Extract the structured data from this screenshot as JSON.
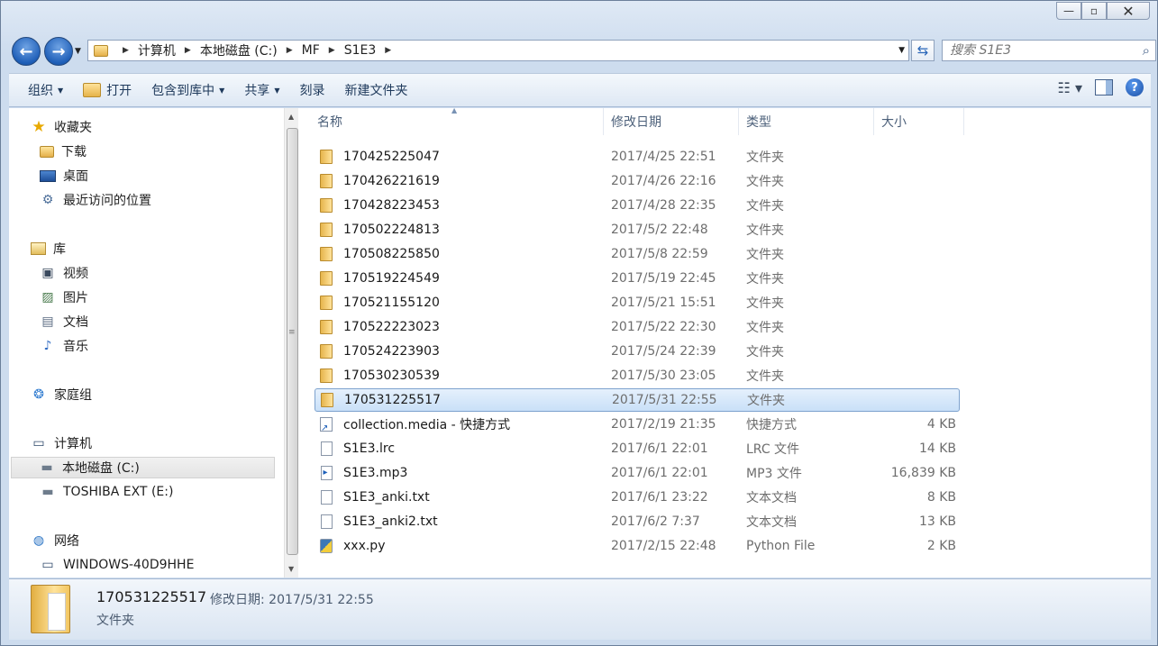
{
  "window": {
    "caption": {
      "minimize": "—",
      "maximize": "▫",
      "close": "✕"
    }
  },
  "nav": {
    "back_icon": "arrow-left-icon",
    "forward_icon": "arrow-right-icon",
    "breadcrumb": [
      "计算机",
      "本地磁盘 (C:)",
      "MF",
      "S1E3"
    ],
    "search_placeholder": "搜索 S1E3"
  },
  "toolbar": {
    "organize": "组织",
    "open": "打开",
    "include_library": "包含到库中",
    "share": "共享",
    "burn": "刻录",
    "new_folder": "新建文件夹"
  },
  "sidebar": {
    "favorites": "收藏夹",
    "downloads": "下载",
    "desktop": "桌面",
    "recent": "最近访问的位置",
    "libraries": "库",
    "videos": "视频",
    "pictures": "图片",
    "documents": "文档",
    "music": "音乐",
    "homegroup": "家庭组",
    "computer": "计算机",
    "local_disk": "本地磁盘 (C:)",
    "external": "TOSHIBA EXT (E:)",
    "network": "网络",
    "network_pc": "WINDOWS-40D9HHE"
  },
  "columns": {
    "name": "名称",
    "date": "修改日期",
    "type": "类型",
    "size": "大小"
  },
  "files": [
    {
      "name": "170425225047",
      "date": "2017/4/25 22:51",
      "type": "文件夹",
      "size": "",
      "icon": "folder"
    },
    {
      "name": "170426221619",
      "date": "2017/4/26 22:16",
      "type": "文件夹",
      "size": "",
      "icon": "folder"
    },
    {
      "name": "170428223453",
      "date": "2017/4/28 22:35",
      "type": "文件夹",
      "size": "",
      "icon": "folder"
    },
    {
      "name": "170502224813",
      "date": "2017/5/2 22:48",
      "type": "文件夹",
      "size": "",
      "icon": "folder"
    },
    {
      "name": "170508225850",
      "date": "2017/5/8 22:59",
      "type": "文件夹",
      "size": "",
      "icon": "folder"
    },
    {
      "name": "170519224549",
      "date": "2017/5/19 22:45",
      "type": "文件夹",
      "size": "",
      "icon": "folder"
    },
    {
      "name": "170521155120",
      "date": "2017/5/21 15:51",
      "type": "文件夹",
      "size": "",
      "icon": "folder"
    },
    {
      "name": "170522223023",
      "date": "2017/5/22 22:30",
      "type": "文件夹",
      "size": "",
      "icon": "folder"
    },
    {
      "name": "170524223903",
      "date": "2017/5/24 22:39",
      "type": "文件夹",
      "size": "",
      "icon": "folder"
    },
    {
      "name": "170530230539",
      "date": "2017/5/30 23:05",
      "type": "文件夹",
      "size": "",
      "icon": "folder"
    },
    {
      "name": "170531225517",
      "date": "2017/5/31 22:55",
      "type": "文件夹",
      "size": "",
      "icon": "folder",
      "selected": true
    },
    {
      "name": "collection.media - 快捷方式",
      "date": "2017/2/19 21:35",
      "type": "快捷方式",
      "size": "4 KB",
      "icon": "shortcut"
    },
    {
      "name": "S1E3.lrc",
      "date": "2017/6/1 22:01",
      "type": "LRC 文件",
      "size": "14 KB",
      "icon": "text"
    },
    {
      "name": "S1E3.mp3",
      "date": "2017/6/1 22:01",
      "type": "MP3 文件",
      "size": "16,839 KB",
      "icon": "audio"
    },
    {
      "name": "S1E3_anki.txt",
      "date": "2017/6/1 23:22",
      "type": "文本文档",
      "size": "8 KB",
      "icon": "text"
    },
    {
      "name": "S1E3_anki2.txt",
      "date": "2017/6/2 7:37",
      "type": "文本文档",
      "size": "13 KB",
      "icon": "text"
    },
    {
      "name": "xxx.py",
      "date": "2017/2/15 22:48",
      "type": "Python File",
      "size": "2 KB",
      "icon": "python"
    }
  ],
  "details": {
    "name": "170531225517",
    "meta": "修改日期: 2017/5/31 22:55",
    "type": "文件夹"
  }
}
